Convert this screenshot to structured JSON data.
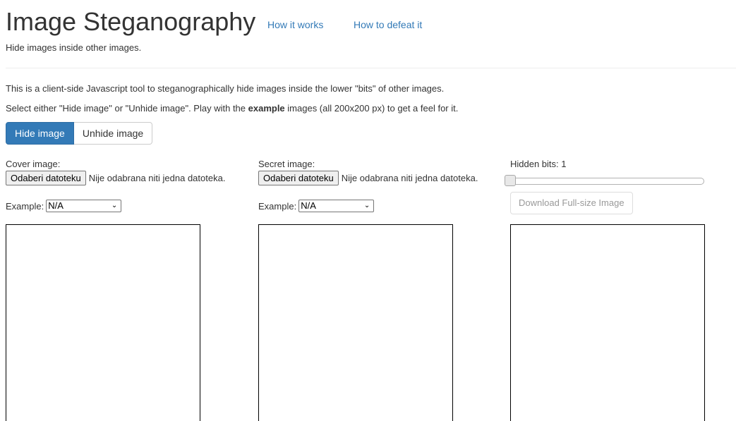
{
  "header": {
    "title": "Image Steganography",
    "nav": [
      "How it works",
      "How to defeat it"
    ],
    "subtitle": "Hide images inside other images."
  },
  "intro": {
    "line1": "This is a client-side Javascript tool to steganographically hide images inside the lower \"bits\" of other images.",
    "line2_before": "Select either \"Hide image\" or \"Unhide image\". Play with the ",
    "line2_bold": "example",
    "line2_after": " images (all 200x200 px) to get a feel for it."
  },
  "mode_buttons": {
    "hide": "Hide image",
    "unhide": "Unhide image",
    "active": "hide"
  },
  "cover": {
    "label": "Cover image:",
    "file_button": "Odaberi datoteku",
    "file_status": "Nije odabrana niti jedna datoteka.",
    "example_label": "Example:",
    "example_value": "N/A"
  },
  "secret": {
    "label": "Secret image:",
    "file_button": "Odaberi datoteku",
    "file_status": "Nije odabrana niti jedna datoteka.",
    "example_label": "Example:",
    "example_value": "N/A"
  },
  "output": {
    "hidden_bits_label": "Hidden bits: 1",
    "hidden_bits_value": 1,
    "download_label": "Download Full-size Image"
  },
  "colors": {
    "primary": "#337ab7",
    "link": "#337ab7",
    "text": "#333333"
  }
}
